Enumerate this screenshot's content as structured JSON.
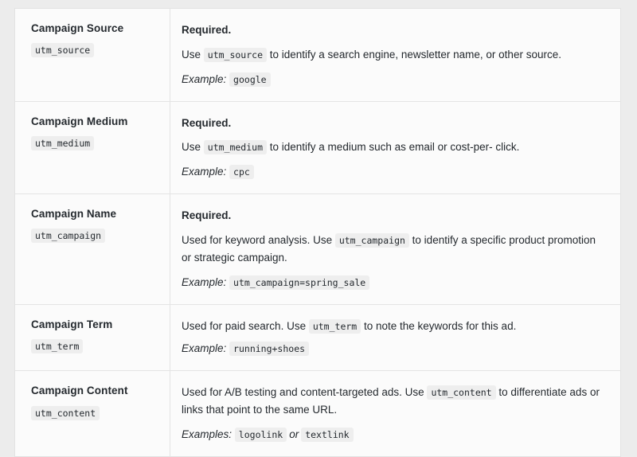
{
  "table": {
    "rows": [
      {
        "param_title": "Campaign Source",
        "param_code": "utm_source",
        "required_label": "Required.",
        "desc_pre": "Use ",
        "desc_code": "utm_source",
        "desc_post": " to identify a search engine, newsletter name, or other source.",
        "example_label": "Example:",
        "example_values": [
          "google"
        ]
      },
      {
        "param_title": "Campaign Medium",
        "param_code": "utm_medium",
        "required_label": "Required.",
        "desc_pre": "Use ",
        "desc_code": "utm_medium",
        "desc_post": " to identify a medium such as email or cost-per- click.",
        "example_label": "Example:",
        "example_values": [
          "cpc"
        ]
      },
      {
        "param_title": "Campaign Name",
        "param_code": "utm_campaign",
        "required_label": "Required.",
        "desc_pre": "Used for keyword analysis. Use ",
        "desc_code": "utm_campaign",
        "desc_post": " to identify a specific product promotion or strategic campaign.",
        "example_label": "Example:",
        "example_values": [
          "utm_campaign=spring_sale"
        ]
      },
      {
        "param_title": "Campaign Term",
        "param_code": "utm_term",
        "required_label": "",
        "desc_pre": "Used for paid search. Use ",
        "desc_code": "utm_term",
        "desc_post": " to note the keywords for this ad.",
        "example_label": "Example:",
        "example_values": [
          "running+shoes"
        ]
      },
      {
        "param_title": "Campaign Content",
        "param_code": "utm_content",
        "required_label": "",
        "desc_pre": "Used for A/B testing and content-targeted ads. Use ",
        "desc_code": "utm_content",
        "desc_post": " to differentiate ads or links that point to the same URL.",
        "example_label": "Examples:",
        "example_values": [
          "logolink",
          "textlink"
        ],
        "example_separator": "or"
      }
    ]
  },
  "colors": {
    "page_background": "#ececec",
    "table_background": "#fbfbfb",
    "border": "#e4e4e4",
    "text": "#24292e",
    "code_chip_background": "#eeeeee"
  }
}
